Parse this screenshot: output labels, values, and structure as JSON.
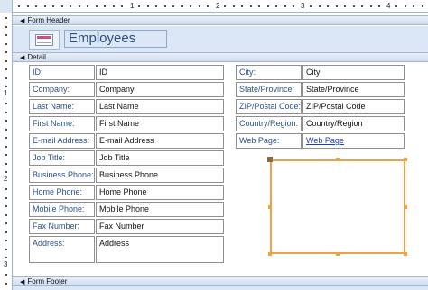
{
  "sections": {
    "header": "Form Header",
    "detail": "Detail",
    "footer": "Form Footer"
  },
  "header": {
    "title": "Employees",
    "icon": "form-icon"
  },
  "ruler": {
    "top_numbers": [
      "1",
      "2",
      "3",
      "4",
      "5"
    ],
    "left_numbers": [
      "1",
      "2",
      "3"
    ]
  },
  "left_fields": [
    {
      "label": "ID:",
      "control": "ID"
    },
    {
      "label": "Company:",
      "control": "Company"
    },
    {
      "label": "Last Name:",
      "control": "Last Name"
    },
    {
      "label": "First Name:",
      "control": "First Name"
    },
    {
      "label": "E-mail Address:",
      "control": "E-mail Address"
    },
    {
      "label": "Job Title:",
      "control": "Job Title"
    },
    {
      "label": "Business Phone:",
      "control": "Business Phone"
    },
    {
      "label": "Home Phone:",
      "control": "Home Phone"
    },
    {
      "label": "Mobile Phone:",
      "control": "Mobile Phone"
    },
    {
      "label": "Fax Number:",
      "control": "Fax Number"
    },
    {
      "label": "Address:",
      "control": "Address"
    }
  ],
  "right_fields": [
    {
      "label": "City:",
      "control": "City"
    },
    {
      "label": "State/Province:",
      "control": "State/Province"
    },
    {
      "label": "ZIP/Postal Code:",
      "control": "ZIP/Postal Code"
    },
    {
      "label": "Country/Region:",
      "control": "Country/Region"
    },
    {
      "label": "Web Page:",
      "control": "Web Page"
    }
  ],
  "colors": {
    "label_text": "#2b4f7f",
    "selection": "#f0a23c",
    "section_bar": "#cfdcee"
  }
}
